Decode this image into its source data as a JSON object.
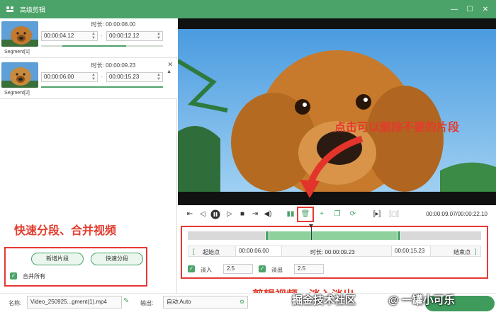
{
  "window": {
    "title": "高级剪辑",
    "controls": [
      "minimize-icon",
      "maximize-icon",
      "close-icon"
    ]
  },
  "segments": [
    {
      "label": "Segment[1]",
      "duration_label": "时长: 00:00:08.00",
      "start": "00:00:04.12",
      "end": "00:00:12.12",
      "dash": "-"
    },
    {
      "label": "Segment[2]",
      "duration_label": "时长: 00:00:09.23",
      "start": "00:00:06.00",
      "end": "00:00:15.23",
      "dash": "-"
    }
  ],
  "annotations": {
    "left": "快速分段、合并视频",
    "video": "点击可以删除不要的片段",
    "bottom": "剪辑视频，淡入淡出"
  },
  "left_controls": {
    "add_segment": "新增片段",
    "quick_split": "快速分段",
    "merge_all": "合并所有",
    "merge_all_checked": true
  },
  "player": {
    "time_display": "00:00:09.07/00:00:22.10",
    "buttons": [
      "start-marker-icon",
      "prev-frame-icon",
      "pause-icon",
      "next-frame-icon",
      "stop-icon",
      "end-marker-icon",
      "volume-icon",
      "split-icon",
      "delete-icon",
      "add-icon",
      "copy-icon",
      "refresh-icon",
      "bracket-play-icon",
      "crop-icon"
    ]
  },
  "editor": {
    "start_label": "起始点",
    "start_value": "00:00:06.00",
    "duration_label": "时长: 00:00:09.23",
    "end_value": "00:00:15.23",
    "end_label": "结束点",
    "selection_start_frac": 0.27,
    "selection_end_frac": 0.72,
    "fade_in_label": "淡入",
    "fade_in_value": "2.5",
    "fade_in_checked": true,
    "fade_out_label": "淡出",
    "fade_out_value": "2.5",
    "fade_out_checked": true
  },
  "bottom_bar": {
    "name_label": "名称:",
    "name_value": "Video_250925...gment(1).mp4",
    "output_label": "输出:",
    "output_value": "自动:Auto"
  },
  "watermark": {
    "left": "掘金技术社区",
    "right": "@ 一罐小可乐"
  },
  "colors": {
    "brand_green": "#4ca36a",
    "annotation_red": "#e23c2d"
  }
}
